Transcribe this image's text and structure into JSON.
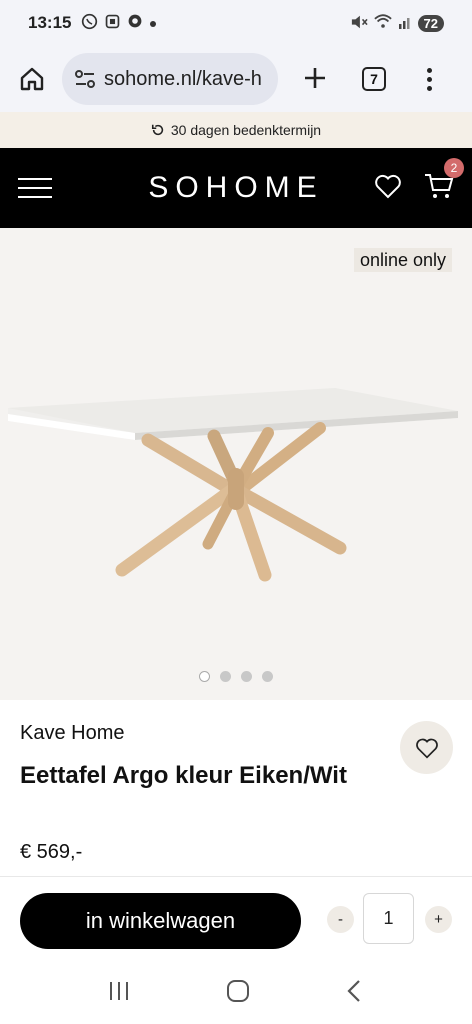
{
  "status": {
    "time": "13:15",
    "battery": "72"
  },
  "browser": {
    "url": "sohome.nl/kave-h",
    "tab_count": "7"
  },
  "promo": {
    "text": "30 dagen bedenktermijn"
  },
  "header": {
    "logo": "SOHOME",
    "cart_count": "2"
  },
  "gallery": {
    "badge": "online only",
    "dots": 4,
    "active_dot": 0
  },
  "product": {
    "brand": "Kave Home",
    "title": "Eettafel Argo kleur Eiken/Wit",
    "price": "€ 569,-"
  },
  "buy": {
    "add_to_cart": "in winkelwagen",
    "minus": "-",
    "plus": "+",
    "quantity": "1"
  },
  "colors": {
    "header_bg": "#000000",
    "promo_bg": "#f4efe7",
    "cart_badge": "#d36b6b",
    "soft_button": "#efebe5"
  }
}
